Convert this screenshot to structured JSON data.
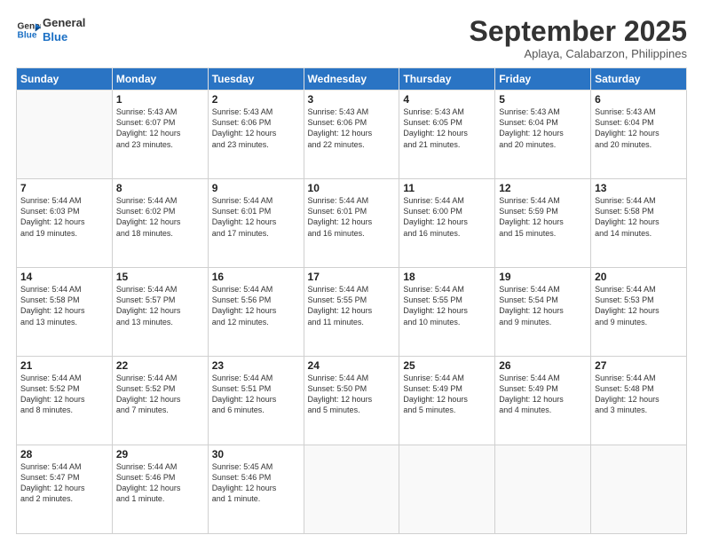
{
  "logo": {
    "line1": "General",
    "line2": "Blue"
  },
  "header": {
    "month": "September 2025",
    "location": "Aplaya, Calabarzon, Philippines"
  },
  "weekdays": [
    "Sunday",
    "Monday",
    "Tuesday",
    "Wednesday",
    "Thursday",
    "Friday",
    "Saturday"
  ],
  "weeks": [
    [
      {
        "day": "",
        "info": ""
      },
      {
        "day": "1",
        "info": "Sunrise: 5:43 AM\nSunset: 6:07 PM\nDaylight: 12 hours\nand 23 minutes."
      },
      {
        "day": "2",
        "info": "Sunrise: 5:43 AM\nSunset: 6:06 PM\nDaylight: 12 hours\nand 23 minutes."
      },
      {
        "day": "3",
        "info": "Sunrise: 5:43 AM\nSunset: 6:06 PM\nDaylight: 12 hours\nand 22 minutes."
      },
      {
        "day": "4",
        "info": "Sunrise: 5:43 AM\nSunset: 6:05 PM\nDaylight: 12 hours\nand 21 minutes."
      },
      {
        "day": "5",
        "info": "Sunrise: 5:43 AM\nSunset: 6:04 PM\nDaylight: 12 hours\nand 20 minutes."
      },
      {
        "day": "6",
        "info": "Sunrise: 5:43 AM\nSunset: 6:04 PM\nDaylight: 12 hours\nand 20 minutes."
      }
    ],
    [
      {
        "day": "7",
        "info": "Sunrise: 5:44 AM\nSunset: 6:03 PM\nDaylight: 12 hours\nand 19 minutes."
      },
      {
        "day": "8",
        "info": "Sunrise: 5:44 AM\nSunset: 6:02 PM\nDaylight: 12 hours\nand 18 minutes."
      },
      {
        "day": "9",
        "info": "Sunrise: 5:44 AM\nSunset: 6:01 PM\nDaylight: 12 hours\nand 17 minutes."
      },
      {
        "day": "10",
        "info": "Sunrise: 5:44 AM\nSunset: 6:01 PM\nDaylight: 12 hours\nand 16 minutes."
      },
      {
        "day": "11",
        "info": "Sunrise: 5:44 AM\nSunset: 6:00 PM\nDaylight: 12 hours\nand 16 minutes."
      },
      {
        "day": "12",
        "info": "Sunrise: 5:44 AM\nSunset: 5:59 PM\nDaylight: 12 hours\nand 15 minutes."
      },
      {
        "day": "13",
        "info": "Sunrise: 5:44 AM\nSunset: 5:58 PM\nDaylight: 12 hours\nand 14 minutes."
      }
    ],
    [
      {
        "day": "14",
        "info": "Sunrise: 5:44 AM\nSunset: 5:58 PM\nDaylight: 12 hours\nand 13 minutes."
      },
      {
        "day": "15",
        "info": "Sunrise: 5:44 AM\nSunset: 5:57 PM\nDaylight: 12 hours\nand 13 minutes."
      },
      {
        "day": "16",
        "info": "Sunrise: 5:44 AM\nSunset: 5:56 PM\nDaylight: 12 hours\nand 12 minutes."
      },
      {
        "day": "17",
        "info": "Sunrise: 5:44 AM\nSunset: 5:55 PM\nDaylight: 12 hours\nand 11 minutes."
      },
      {
        "day": "18",
        "info": "Sunrise: 5:44 AM\nSunset: 5:55 PM\nDaylight: 12 hours\nand 10 minutes."
      },
      {
        "day": "19",
        "info": "Sunrise: 5:44 AM\nSunset: 5:54 PM\nDaylight: 12 hours\nand 9 minutes."
      },
      {
        "day": "20",
        "info": "Sunrise: 5:44 AM\nSunset: 5:53 PM\nDaylight: 12 hours\nand 9 minutes."
      }
    ],
    [
      {
        "day": "21",
        "info": "Sunrise: 5:44 AM\nSunset: 5:52 PM\nDaylight: 12 hours\nand 8 minutes."
      },
      {
        "day": "22",
        "info": "Sunrise: 5:44 AM\nSunset: 5:52 PM\nDaylight: 12 hours\nand 7 minutes."
      },
      {
        "day": "23",
        "info": "Sunrise: 5:44 AM\nSunset: 5:51 PM\nDaylight: 12 hours\nand 6 minutes."
      },
      {
        "day": "24",
        "info": "Sunrise: 5:44 AM\nSunset: 5:50 PM\nDaylight: 12 hours\nand 5 minutes."
      },
      {
        "day": "25",
        "info": "Sunrise: 5:44 AM\nSunset: 5:49 PM\nDaylight: 12 hours\nand 5 minutes."
      },
      {
        "day": "26",
        "info": "Sunrise: 5:44 AM\nSunset: 5:49 PM\nDaylight: 12 hours\nand 4 minutes."
      },
      {
        "day": "27",
        "info": "Sunrise: 5:44 AM\nSunset: 5:48 PM\nDaylight: 12 hours\nand 3 minutes."
      }
    ],
    [
      {
        "day": "28",
        "info": "Sunrise: 5:44 AM\nSunset: 5:47 PM\nDaylight: 12 hours\nand 2 minutes."
      },
      {
        "day": "29",
        "info": "Sunrise: 5:44 AM\nSunset: 5:46 PM\nDaylight: 12 hours\nand 1 minute."
      },
      {
        "day": "30",
        "info": "Sunrise: 5:45 AM\nSunset: 5:46 PM\nDaylight: 12 hours\nand 1 minute."
      },
      {
        "day": "",
        "info": ""
      },
      {
        "day": "",
        "info": ""
      },
      {
        "day": "",
        "info": ""
      },
      {
        "day": "",
        "info": ""
      }
    ]
  ]
}
